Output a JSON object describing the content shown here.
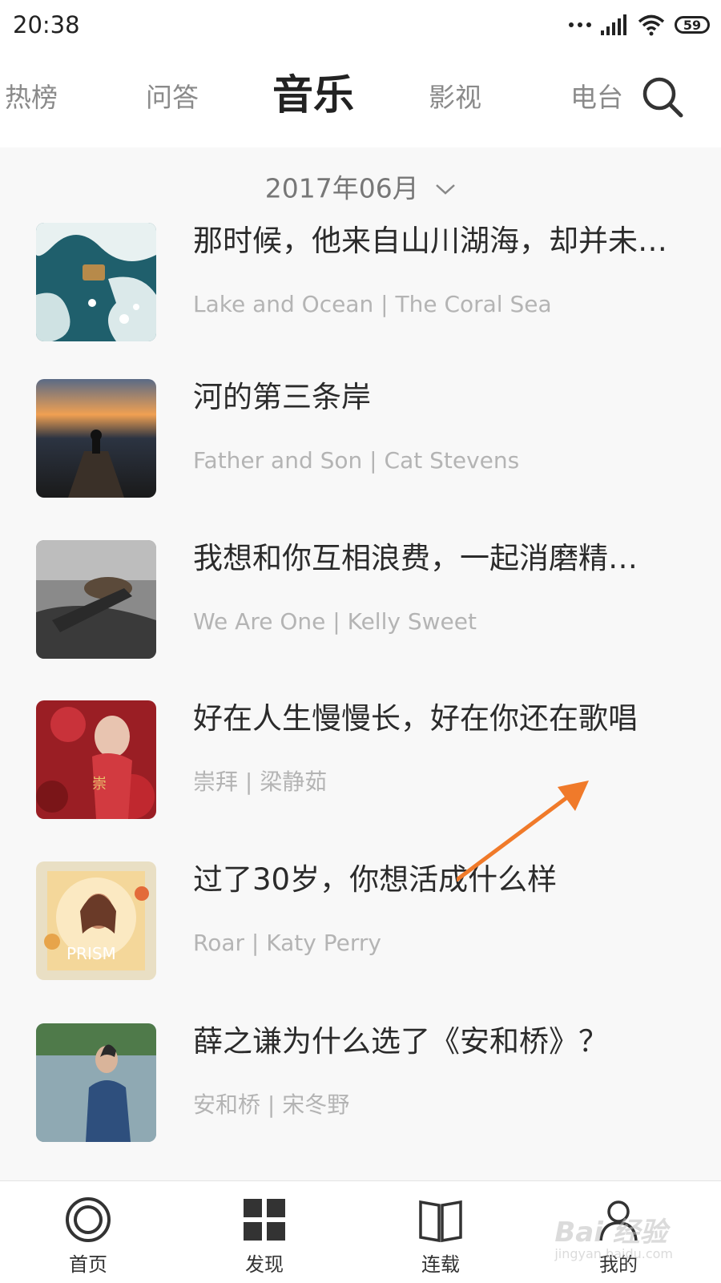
{
  "status_bar": {
    "time": "20:38",
    "battery": "59"
  },
  "tabs": [
    {
      "label": "热榜"
    },
    {
      "label": "问答"
    },
    {
      "label": "音乐",
      "active": true
    },
    {
      "label": "影视"
    },
    {
      "label": "电台"
    }
  ],
  "search_icon": "search-icon",
  "date_filter": {
    "label": "2017年06月",
    "icon": "chevron-down-icon"
  },
  "items": [
    {
      "title": "那时候，他来自山川湖海，却并未…",
      "subtitle": "Lake and Ocean | The Coral Sea"
    },
    {
      "title": "河的第三条岸",
      "subtitle": "Father and Son | Cat Stevens"
    },
    {
      "title": "我想和你互相浪费，一起消磨精…",
      "subtitle": "We Are One | Kelly Sweet"
    },
    {
      "title": "好在人生慢慢长，好在你还在歌唱",
      "subtitle": "崇拜 | 梁静茹"
    },
    {
      "title": "过了30岁，你想活成什么样",
      "subtitle": "Roar  | Katy Perry"
    },
    {
      "title": "薛之谦为什么选了《安和桥》？",
      "subtitle": "安和桥 | 宋冬野"
    }
  ],
  "bottom_nav": [
    {
      "label": "首页",
      "icon": "home-ring-icon"
    },
    {
      "label": "发现",
      "icon": "grid-icon"
    },
    {
      "label": "连载",
      "icon": "book-icon"
    },
    {
      "label": "我的",
      "icon": "user-icon"
    }
  ],
  "annotation_arrow_color": "#f07a2a",
  "watermark": {
    "text": "Bai 经验",
    "sub": "jingyan.baidu.com"
  }
}
